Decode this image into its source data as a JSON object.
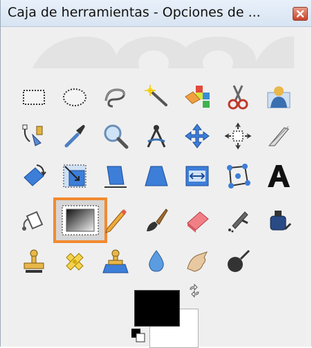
{
  "window": {
    "title": "Caja de herramientas - Opciones de ..."
  },
  "colors": {
    "accent": "#f28a30",
    "fg": "#000000",
    "bg": "#ffffff"
  },
  "tools": [
    "rect-select-icon",
    "ellipse-select-icon",
    "free-select-icon",
    "fuzzy-select-icon",
    "select-by-color-icon",
    "scissors-select-icon",
    "foreground-select-icon",
    "paths-icon",
    "color-picker-icon",
    "zoom-icon",
    "measure-icon",
    "move-icon",
    "align-icon",
    "crop-icon",
    "rotate-icon",
    "scale-icon",
    "shear-icon",
    "perspective-icon",
    "flip-icon",
    "cage-transform-icon",
    "text-icon",
    "bucket-fill-icon",
    "blend-icon",
    "pencil-icon",
    "paintbrush-icon",
    "eraser-icon",
    "airbrush-icon",
    "ink-icon",
    "clone-icon",
    "heal-icon",
    "perspective-clone-icon",
    "blur-sharpen-icon",
    "smudge-icon",
    "dodge-burn-icon"
  ]
}
